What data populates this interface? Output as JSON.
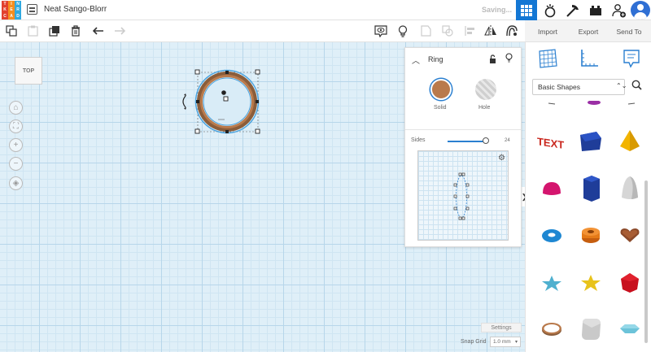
{
  "header": {
    "logo_letters": [
      "T",
      "I",
      "N",
      "K",
      "E",
      "R",
      "C",
      "A",
      "D"
    ],
    "logo_colors": [
      "#e2402e",
      "#f58d1f",
      "#31a9e0",
      "#e2402e",
      "#f58d1f",
      "#31a9e0",
      "#e2402e",
      "#f58d1f",
      "#31a9e0"
    ],
    "doc_title": "Neat Sango-Blorr",
    "status": "Saving..."
  },
  "toolbar_right": {
    "import": "Import",
    "export": "Export",
    "send_to": "Send To"
  },
  "workplane": {
    "view_cube_label": "TOP"
  },
  "inspector": {
    "title": "Ring",
    "solid_label": "Solid",
    "hole_label": "Hole",
    "solid_color": "#b97a4c",
    "sides_label": "Sides",
    "sides_value": "24"
  },
  "bottom": {
    "settings_label": "Settings",
    "snap_grid_label": "Snap Grid",
    "snap_grid_value": "1.0 mm"
  },
  "shapes_panel": {
    "library": "Basic Shapes",
    "shapes": [
      {
        "name": "text"
      },
      {
        "name": "polygon"
      },
      {
        "name": "pyramid"
      },
      {
        "name": "half-sphere"
      },
      {
        "name": "hexagonal-prism"
      },
      {
        "name": "paraboloid"
      },
      {
        "name": "torus"
      },
      {
        "name": "tube"
      },
      {
        "name": "heart"
      },
      {
        "name": "star"
      },
      {
        "name": "star-yellow"
      },
      {
        "name": "icosahedron"
      },
      {
        "name": "ring"
      },
      {
        "name": "rounded-box"
      },
      {
        "name": "diamond"
      }
    ]
  },
  "colors": {
    "accent": "#1477d4",
    "selection": "#4aa3df"
  }
}
